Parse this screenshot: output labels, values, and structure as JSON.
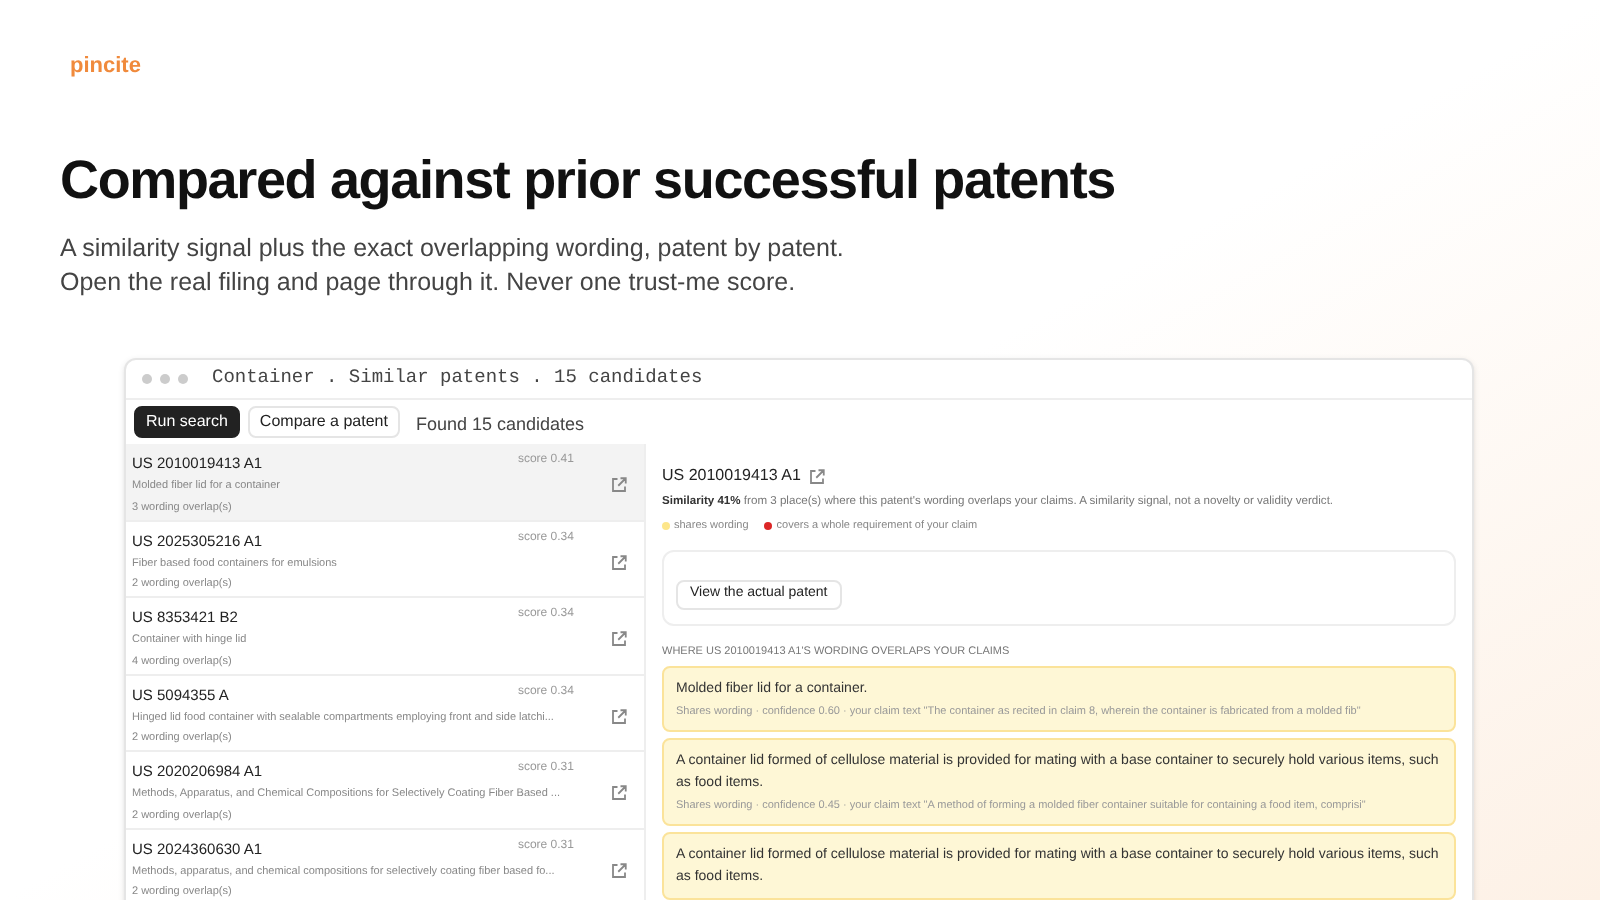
{
  "logo": "pincite",
  "hero": {
    "title": "Compared against prior successful patents",
    "lines": [
      "A similarity signal plus the exact overlapping wording, patent by patent.",
      "Open the real filing and page through it. Never one trust-me score."
    ]
  },
  "window": {
    "title": "Container . Similar patents . 15 candidates"
  },
  "toolbar": {
    "buttons": [
      {
        "label": "Run search",
        "kind": "primary"
      },
      {
        "label": "Compare a patent",
        "kind": "secondary"
      }
    ],
    "status": "Found 15 candidates"
  },
  "results": [
    {
      "number": "US 2010019413 A1",
      "score": "score 0.41",
      "title": "Molded fiber lid for a container",
      "overlaps": "3 wording overlap(s)",
      "selected": true
    },
    {
      "number": "US 2025305216 A1",
      "score": "score 0.34",
      "title": "Fiber based food containers for emulsions",
      "overlaps": "2 wording overlap(s)",
      "selected": false
    },
    {
      "number": "US 8353421 B2",
      "score": "score 0.34",
      "title": "Container with hinge lid",
      "overlaps": "4 wording overlap(s)",
      "selected": false
    },
    {
      "number": "US 5094355 A",
      "score": "score 0.34",
      "title": "Hinged lid food container with sealable compartments employing front and side latchi...",
      "overlaps": "2 wording overlap(s)",
      "selected": false
    },
    {
      "number": "US 2020206984 A1",
      "score": "score 0.31",
      "title": "Methods, Apparatus, and Chemical Compositions for Selectively Coating Fiber Based ...",
      "overlaps": "2 wording overlap(s)",
      "selected": false
    },
    {
      "number": "US 2024360630 A1",
      "score": "score 0.31",
      "title": "Methods, apparatus, and chemical compositions for selectively coating fiber based fo...",
      "overlaps": "2 wording overlap(s)",
      "selected": false
    }
  ],
  "detail": {
    "number": "US 2010019413 A1",
    "summary": "**Similarity 41%** from 3 place(s) where this patent's wording overlaps your claims. A similarity signal, not a novelty or validity verdict.",
    "legend": [
      {
        "label": "shares wording",
        "color": "#fde68a"
      },
      {
        "label": "covers a whole requirement of your claim",
        "color": "#dc2626"
      }
    ],
    "action": "View the actual patent",
    "section_title": "WHERE US 2010019413 A1'S WORDING OVERLAPS YOUR CLAIMS",
    "matches": [
      {
        "text": "Molded fiber lid for a container.",
        "meta": "Shares wording · confidence 0.60 · your claim text \"The container as recited in claim 8, wherein the container is fabricated from a molded fib\""
      },
      {
        "text": "A container lid formed of cellulose material is provided for mating with a base container to securely hold various items, such as food items.",
        "meta": "Shares wording · confidence 0.45 · your claim text \"A method of forming a molded fiber container suitable for containing a food item, comprisi\""
      },
      {
        "text": "A container lid formed of cellulose material is provided for mating with a base container to securely hold various items, such as food items."
      }
    ]
  }
}
